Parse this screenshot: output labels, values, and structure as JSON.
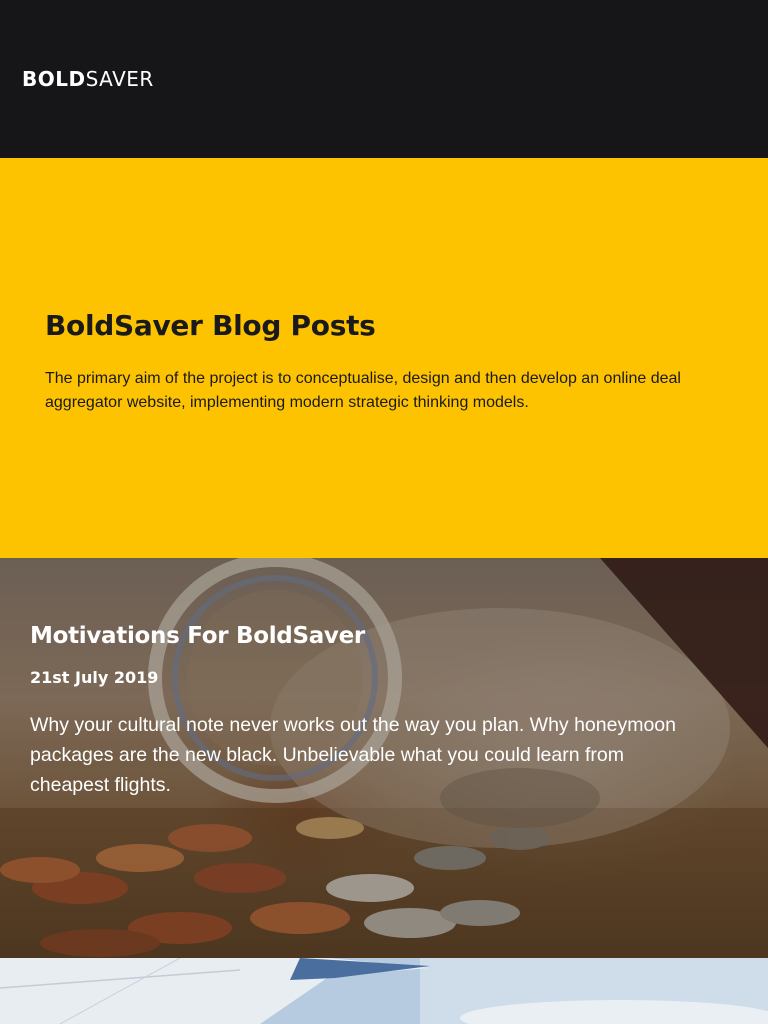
{
  "header": {
    "logo_bold": "BOLD",
    "logo_light": "SAVER"
  },
  "hero": {
    "title": "BoldSaver Blog Posts",
    "description": "The primary aim of the project is to conceptualise, design and then develop an online deal aggregator website, implementing modern strategic thinking models."
  },
  "posts": [
    {
      "title": "Motivations For BoldSaver",
      "date": "21st July 2019",
      "excerpt": "Why your cultural note never works out the way you plan. Why honeymoon packages are the new black. Unbelievable what you could learn from cheapest flights.",
      "image": "coin-jar-photo"
    },
    {
      "image": "airplane-wing-photo"
    }
  ],
  "colors": {
    "header_bg": "#161517",
    "hero_bg": "#fdc300",
    "text_dark": "#1a1a1a",
    "text_light": "#ffffff"
  }
}
